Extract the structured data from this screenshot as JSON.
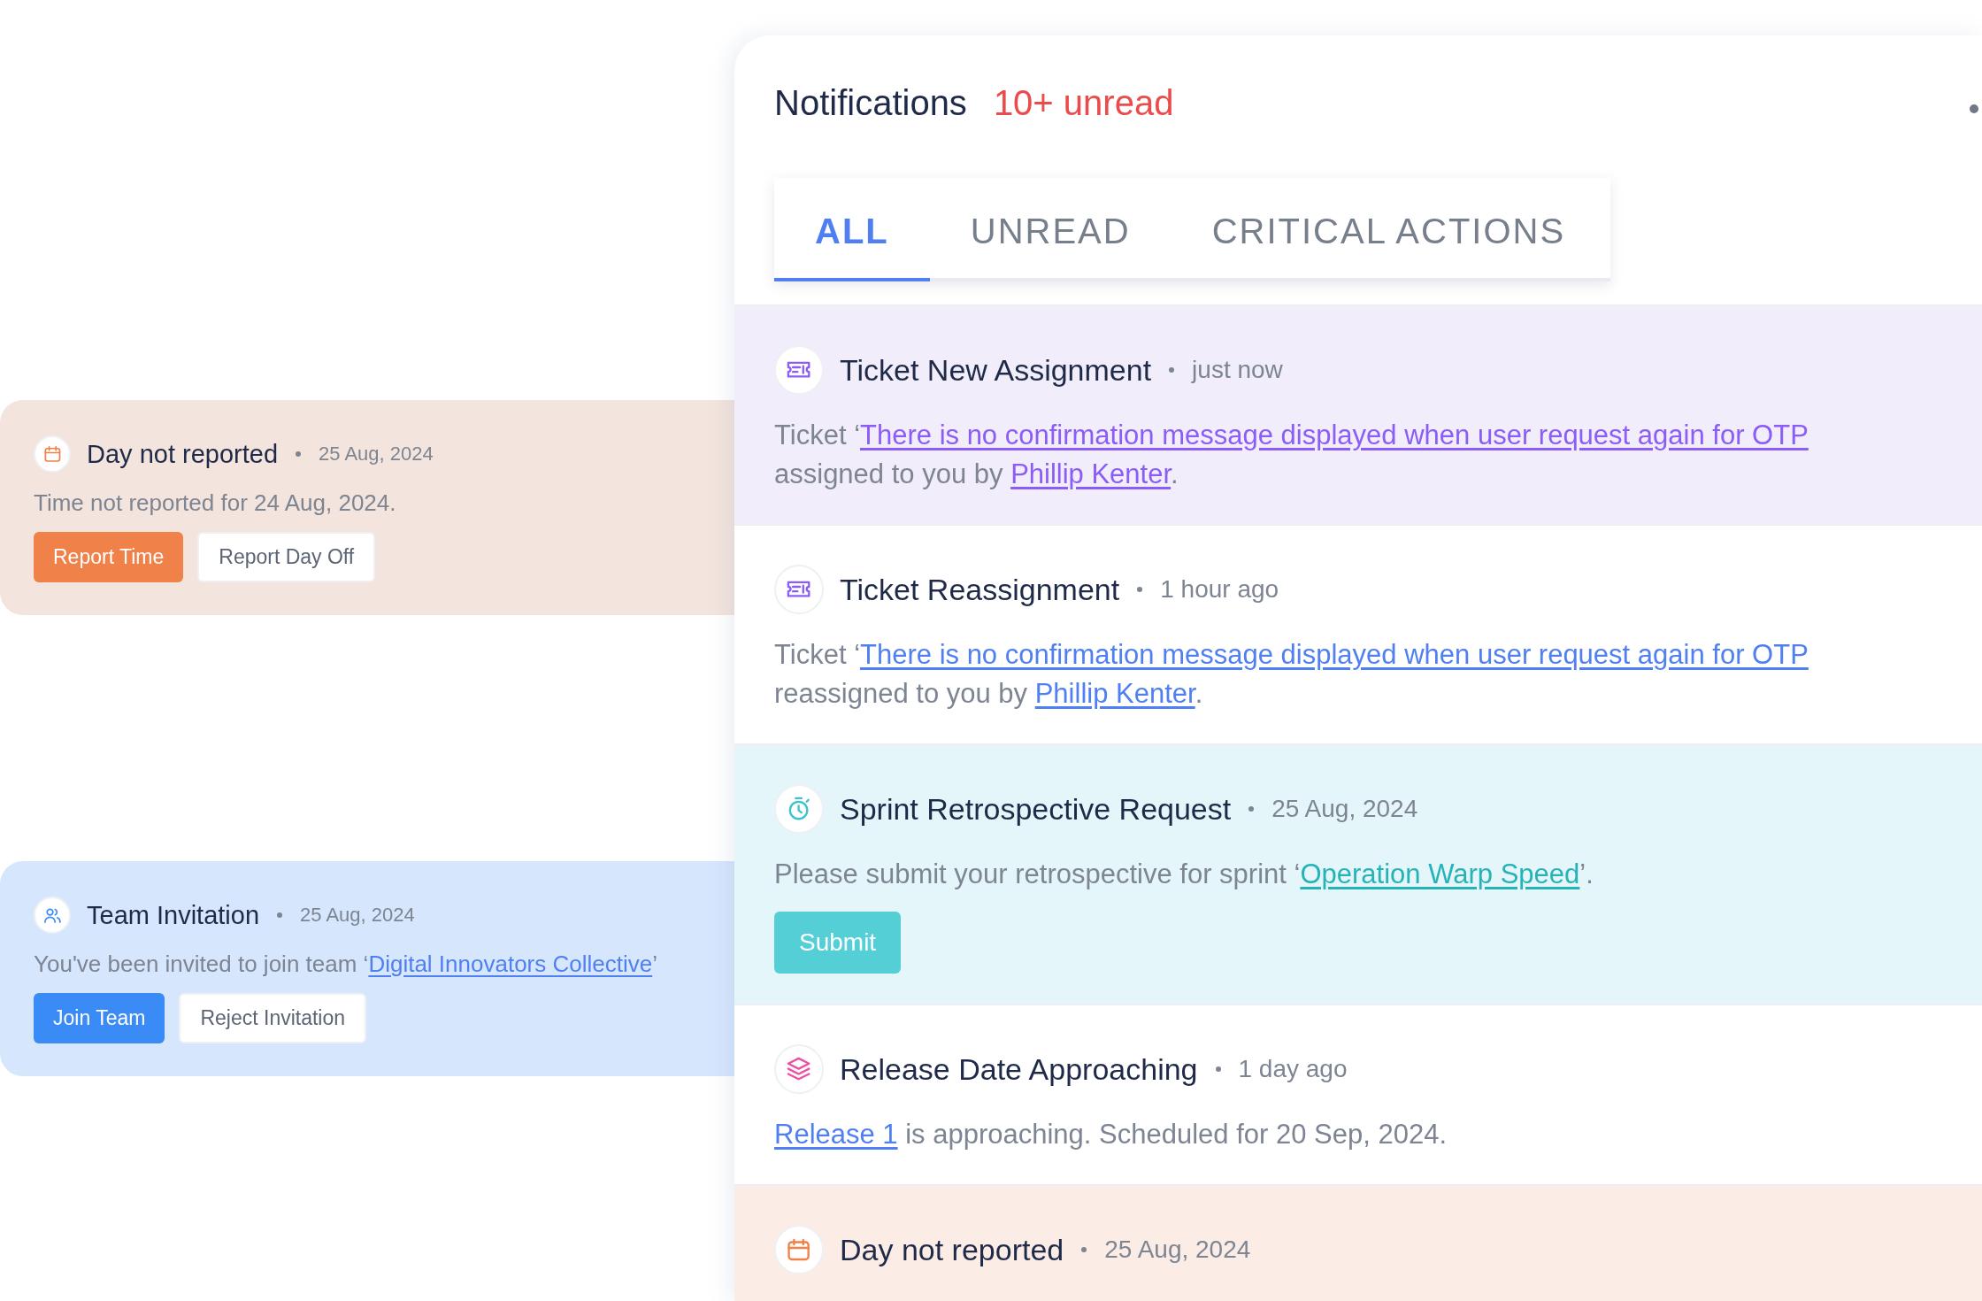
{
  "side_cards": [
    {
      "kind": "day",
      "title": "Day not reported",
      "time": "25 Aug, 2024",
      "body": [
        [
          {
            "text": "Time not reported for 24 Aug, 2024."
          }
        ]
      ],
      "buttons": [
        {
          "label": "Report Time",
          "primary": true
        },
        {
          "label": "Report Day Off",
          "primary": false
        }
      ]
    },
    {
      "kind": "team",
      "title": "Team Invitation",
      "time": "25 Aug, 2024",
      "body": [
        [
          {
            "text": "You've been invited to join team ‘"
          },
          {
            "text": "Digital Innovators Collective",
            "link": true
          },
          {
            "text": "’"
          }
        ]
      ],
      "buttons": [
        {
          "label": "Join Team",
          "primary": true
        },
        {
          "label": "Reject Invitation",
          "primary": false
        }
      ]
    }
  ],
  "panel": {
    "title": "Notifications",
    "unread": "10+ unread",
    "tabs": [
      {
        "label": "ALL",
        "selected": true
      },
      {
        "label": "UNREAD",
        "selected": false
      },
      {
        "label": "CRITICAL ACTIONS",
        "selected": false
      }
    ],
    "items": [
      {
        "kind": "ticket_new",
        "title": "Ticket New Assignment",
        "time": "just now",
        "body": [
          [
            {
              "text": "Ticket ‘"
            },
            {
              "text": "There is no confirmation message displayed when user request again for OTP",
              "link": true
            }
          ],
          [
            {
              "text": "assigned to you by "
            },
            {
              "text": "Phillip Kenter",
              "link": true
            },
            {
              "text": "."
            }
          ]
        ]
      },
      {
        "kind": "ticket",
        "title": "Ticket Reassignment",
        "time": "1 hour ago",
        "body": [
          [
            {
              "text": "Ticket ‘"
            },
            {
              "text": "There is no confirmation message displayed when user request again for OTP",
              "link": true
            }
          ],
          [
            {
              "text": "reassigned to you by "
            },
            {
              "text": "Phillip Kenter",
              "link": true
            },
            {
              "text": "."
            }
          ]
        ]
      },
      {
        "kind": "sprint",
        "title": "Sprint Retrospective Request",
        "time": "25 Aug, 2024",
        "body": [
          [
            {
              "text": "Please submit your retrospective for sprint ‘"
            },
            {
              "text": "Operation Warp Speed",
              "link": true
            },
            {
              "text": "’."
            }
          ]
        ],
        "buttons": [
          {
            "label": "Submit",
            "primary": true
          }
        ]
      },
      {
        "kind": "release",
        "title": "Release Date Approaching",
        "time": "1 day ago",
        "body": [
          [
            {
              "text": "Release 1",
              "link": true
            },
            {
              "text": " is approaching. Scheduled for 20 Sep, 2024."
            }
          ]
        ]
      },
      {
        "kind": "day",
        "title": "Day not reported",
        "time": "25 Aug, 2024"
      }
    ]
  }
}
